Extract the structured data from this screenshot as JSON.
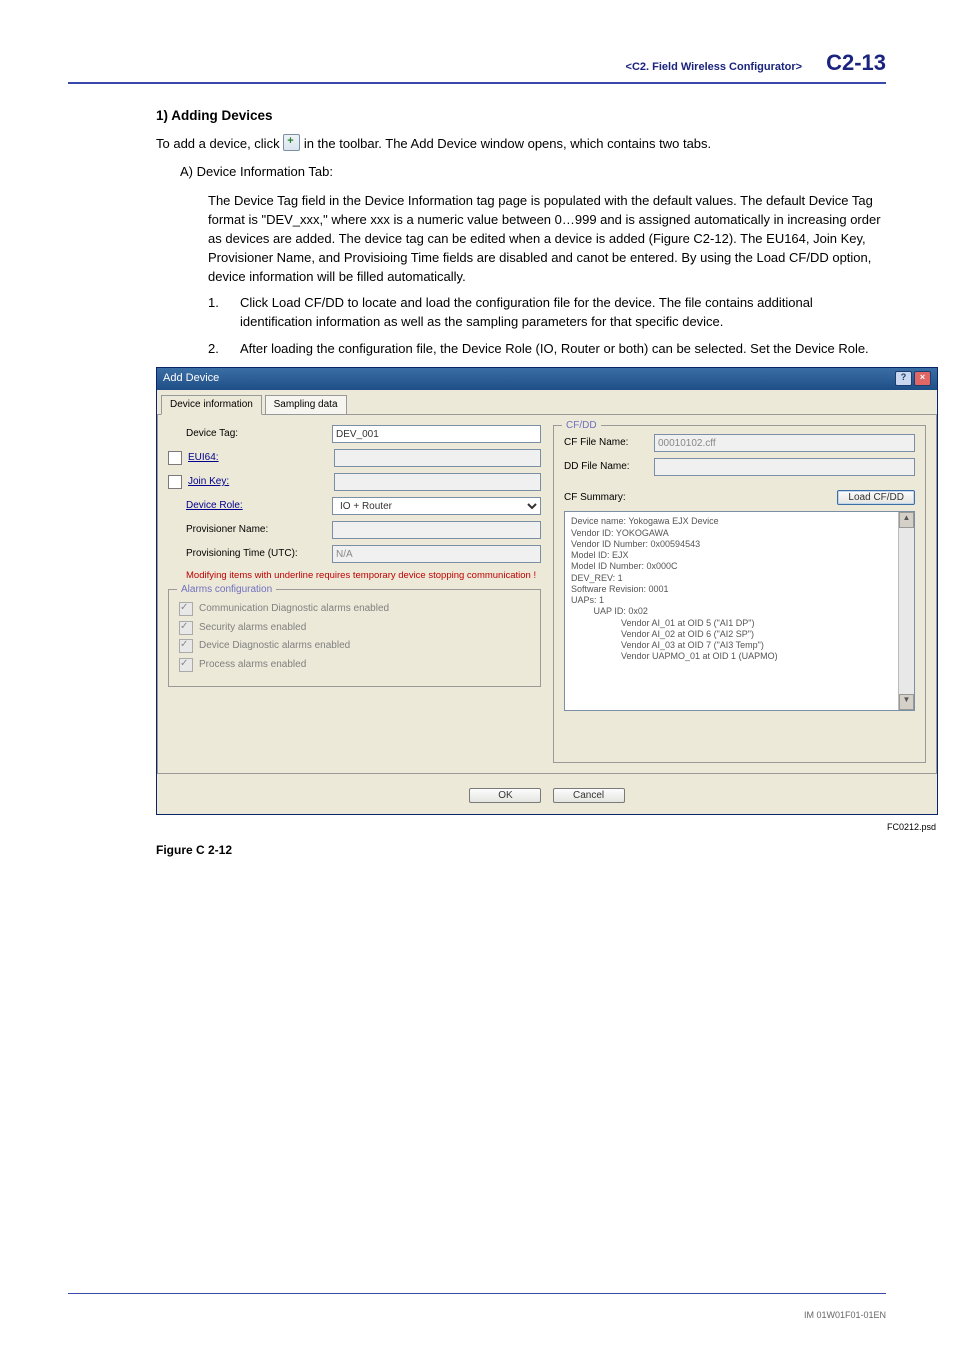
{
  "header": {
    "section": "<C2.  Field Wireless Configurator>",
    "page": "C2-13"
  },
  "h1": "1) Adding Devices",
  "intro_a": "To add a device, click ",
  "intro_b": " in the toolbar. The Add Device window opens, which contains two tabs.",
  "item_a": "A)  Device Information Tab:",
  "para_a": "The Device Tag field in the Device Information tag page is populated with the default values. The default Device Tag format is \"DEV_xxx,\" where xxx is a numeric value between 0…999 and is assigned automatically in increasing order as devices are added. The device tag can be edited when a device is added (Figure C2-12). The EU164, Join Key, Provisioner Name, and Provisioing Time fields are disabled and canot be entered. By using the Load CF/DD option, device information will be filled automatically.",
  "step1": "Click Load CF/DD to locate and load the configuration file for the device. The file contains additional identification information as well as the sampling parameters for that specific device.",
  "step2": "After loading the configuration file, the Device Role (IO, Router or both) can be selected. Set the Device Role.",
  "dialog": {
    "title": "Add Device",
    "tab1": "Device information",
    "tab2": "Sampling data",
    "device_tag_lbl": "Device Tag:",
    "device_tag_val": "DEV_001",
    "eui64_lbl": "EUI64:",
    "join_key_lbl": "Join Key:",
    "device_role_lbl": "Device Role:",
    "device_role_val": "IO + Router",
    "prov_name_lbl": "Provisioner Name:",
    "prov_time_lbl": "Provisioning Time (UTC):",
    "prov_time_val": "N/A",
    "note": "Modifying items with underline requires temporary device stopping communication !",
    "alarms_legend": "Alarms configuration",
    "alarm1": "Communication Diagnostic alarms enabled",
    "alarm2": "Security alarms enabled",
    "alarm3": "Device Diagnostic alarms enabled",
    "alarm4": "Process alarms enabled",
    "cfdd_legend": "CF/DD",
    "cf_file_lbl": "CF File Name:",
    "cf_file_val": "00010102.cff",
    "dd_file_lbl": "DD File Name:",
    "cf_summary_lbl": "CF Summary:",
    "load_btn": "Load CF/DD",
    "summary_text": "Device name: Yokogawa EJX Device\nVendor ID: YOKOGAWA\nVendor ID Number: 0x00594543\nModel ID: EJX\nModel ID Number: 0x000C\nDEV_REV: 1\nSoftware Revision: 0001\nUAPs: 1\n         UAP ID: 0x02\n                    Vendor AI_01 at OID 5 (\"AI1 DP\")\n                    Vendor AI_02 at OID 6 (\"AI2 SP\")\n                    Vendor AI_03 at OID 7 (\"AI3 Temp\")\n                    Vendor UAPMO_01 at OID 1 (UAPMO)",
    "ok": "OK",
    "cancel": "Cancel"
  },
  "caption_right": "FC0212.psd",
  "fig_label": "Figure C 2-12",
  "footer": "IM 01W01F01-01EN"
}
